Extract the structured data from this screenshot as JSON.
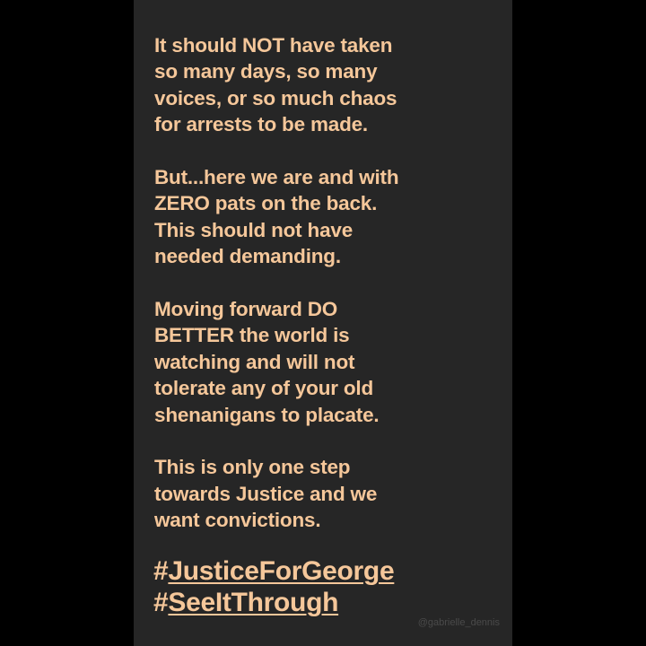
{
  "post": {
    "paragraphs": [
      {
        "lines": [
          "It should NOT have taken",
          "so many days, so many",
          "voices, or so much chaos",
          "for arrests to be made."
        ]
      },
      {
        "lines": [
          "But...here we are and with",
          "ZERO pats on the back.",
          "This should not have",
          "needed demanding."
        ]
      },
      {
        "lines": [
          "Moving forward DO",
          "BETTER the world is",
          "watching and will not",
          "tolerate any of your old",
          "shenanigans to placate."
        ]
      },
      {
        "lines": [
          "This is only one step",
          "towards Justice and we",
          "want convictions."
        ]
      }
    ],
    "hashtags": [
      {
        "symbol": "#",
        "word": "JusticeForGeorge"
      },
      {
        "symbol": "#",
        "word": "SeeItThrough"
      }
    ],
    "watermark": "@gabrielle_dennis"
  },
  "colors": {
    "background": "#000000",
    "panel": "#262626",
    "text": "#f5c79a"
  }
}
